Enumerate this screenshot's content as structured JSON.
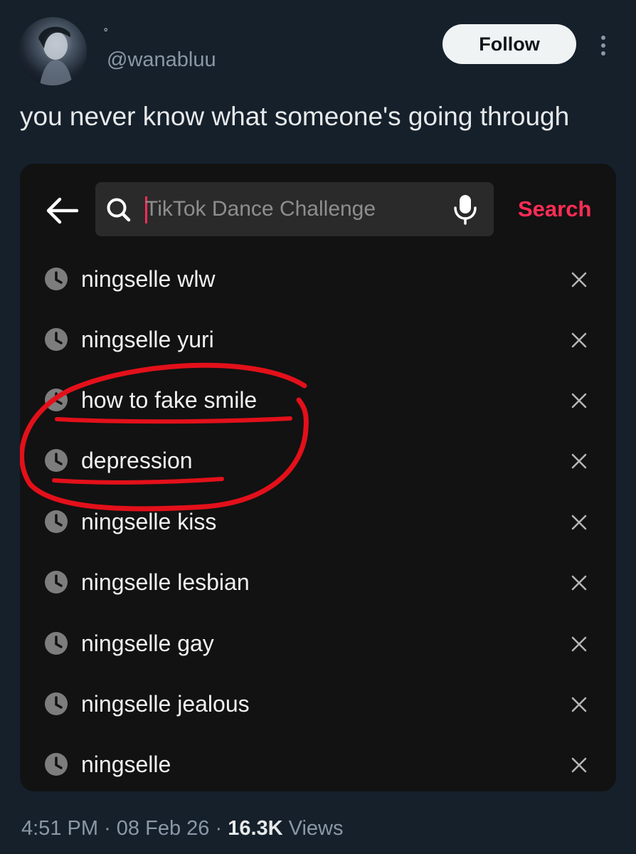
{
  "author": {
    "display_name": "。",
    "handle": "@wanabluu",
    "follow_label": "Follow"
  },
  "tweet": {
    "text": "you never know what someone's going through"
  },
  "media": {
    "search": {
      "placeholder": "TikTok Dance Challenge",
      "button_label": "Search"
    },
    "history": [
      {
        "label": "ningselle wlw"
      },
      {
        "label": "ningselle yuri"
      },
      {
        "label": "how to fake smile"
      },
      {
        "label": "depression"
      },
      {
        "label": "ningselle kiss"
      },
      {
        "label": "ningselle lesbian"
      },
      {
        "label": "ningselle gay"
      },
      {
        "label": "ningselle jealous"
      },
      {
        "label": "ningselle"
      }
    ],
    "accent_color": "#fe2c55",
    "annotation_color": "#e3101a"
  },
  "meta": {
    "time": "4:51 PM",
    "separator": "·",
    "date": "08 Feb 26",
    "views_count": "16.3K",
    "views_label": "Views"
  },
  "icons": [
    "back-arrow-icon",
    "search-icon",
    "microphone-icon",
    "clock-icon",
    "close-icon",
    "more-options-icon"
  ]
}
